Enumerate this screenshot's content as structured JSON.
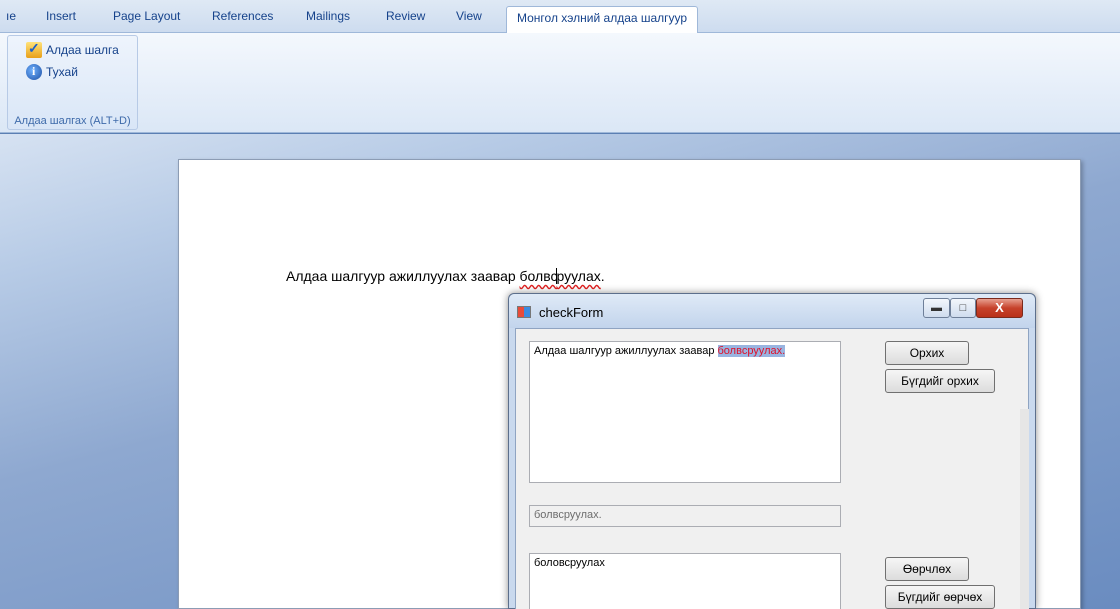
{
  "ribbon": {
    "tabs": [
      {
        "label": "ıe"
      },
      {
        "label": "Insert"
      },
      {
        "label": "Page Layout"
      },
      {
        "label": "References"
      },
      {
        "label": "Mailings"
      },
      {
        "label": "Review"
      },
      {
        "label": "View"
      },
      {
        "label": "Монгол хэлний алдаа шалгуур"
      }
    ],
    "group": {
      "buttons": [
        {
          "label": "Алдаа шалга",
          "icon": "spellcheck-icon"
        },
        {
          "label": "Тухай",
          "icon": "info-icon"
        }
      ],
      "label": "Алдаа шалгах (ALT+D)"
    }
  },
  "document": {
    "text_before": "Алдаа шалгуур ажиллуулах заавар ",
    "misspelled_a": "болвс",
    "misspelled_b": "руулах",
    "text_after": "."
  },
  "dialog": {
    "title": "checkForm",
    "controls": {
      "close": "X"
    },
    "main_text_plain": "Алдаа шалгуур ажиллуулах заавар ",
    "main_text_error": "болвсруулах.",
    "error_word": "болвсруулах.",
    "suggestion": "боловсруулах",
    "buttons": {
      "ignore": "Орхих",
      "ignore_all": "Бүгдийг орхих",
      "change": "Өөрчлөх",
      "change_all": "Бүгдийг өөрчөх"
    }
  }
}
